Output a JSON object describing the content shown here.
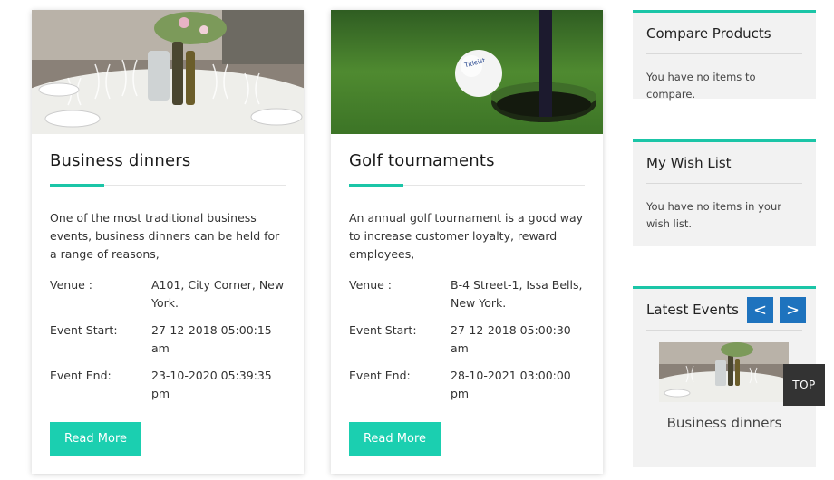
{
  "events": [
    {
      "title": "Business dinners",
      "description": "One of the most traditional business events, business dinners can be held for a range of reasons,",
      "venue_label": "Venue :",
      "venue": "A101, City Corner, New York.",
      "start_label": "Event Start:",
      "start": "27-12-2018 05:00:15 am",
      "end_label": "Event End:",
      "end": "23-10-2020 05:39:35 pm",
      "button": "Read More"
    },
    {
      "title": "Golf tournaments",
      "description": "An annual golf tournament is a good way to increase customer loyalty, reward employees,",
      "venue_label": "Venue :",
      "venue": "B-4 Street-1, Issa Bells, New York.",
      "start_label": "Event Start:",
      "start": "27-12-2018 05:00:30 am",
      "end_label": "Event End:",
      "end": "28-10-2021 03:00:00 pm",
      "button": "Read More"
    }
  ],
  "sidebar": {
    "compare": {
      "title": "Compare Products",
      "text": "You have no items to compare."
    },
    "wishlist": {
      "title": "My Wish List",
      "text": "You have no items in your wish list."
    },
    "latest": {
      "title": "Latest Events",
      "prev": "<",
      "next": ">",
      "caption": "Business dinners"
    }
  },
  "top_button": "TOP",
  "colors": {
    "accent": "#1bc5a7",
    "button": "#1bcfb0",
    "nav": "#1e73be",
    "top": "#333333"
  }
}
